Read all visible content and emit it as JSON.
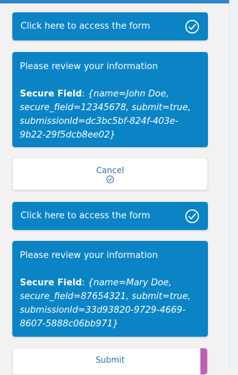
{
  "entries": [
    {
      "form_link": "Click here to access the form",
      "review_title": "Please review your information",
      "field_label": "Secure Field",
      "field_value": "{name=John Doe, secure_field=12345678, submit=true, submissionId=dc3bc5bf-824f-403e-9b22-29f5dcb8ee02}",
      "action_label": "Cancel"
    },
    {
      "form_link": "Click here to access the form",
      "review_title": "Please review your information",
      "field_label": "Secure Field",
      "field_value": "{name=Mary Doe, secure_field=87654321, submit=true, submissionId=33d93820-9729-4669-8607-5888c06bb971}",
      "action_label": "Submit"
    }
  ],
  "colors": {
    "card_blue": "#0b84c6",
    "link_blue": "#2a6fb0",
    "submit_accent": "#c25fb5",
    "top_bar": "#2e86c8"
  },
  "icons": [
    "check-circle-icon",
    "small-check-icon"
  ]
}
